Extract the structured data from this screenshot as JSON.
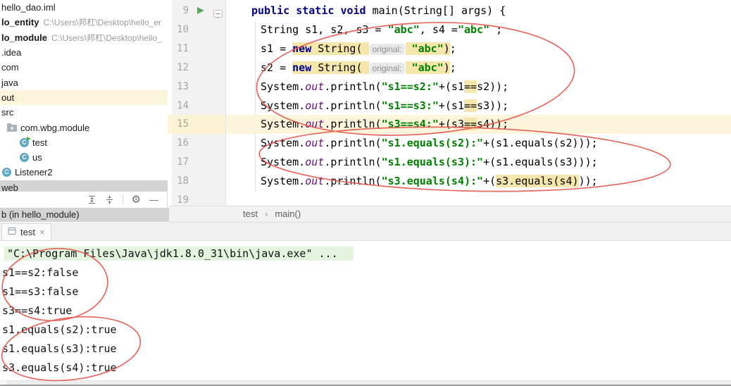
{
  "colors": {
    "keyword": "#000080",
    "string": "#008000",
    "field": "#660E7A",
    "token_highlight": "#F5E6AC",
    "current_line": "#FCF5DB",
    "run_command_bg": "#E4F4DE",
    "annotation": "#E3584F",
    "selection_row": "#D4D4D4",
    "gutter_bg": "#F2F2F2"
  },
  "sidebar": {
    "items": [
      {
        "label": "hello_dao.iml"
      },
      {
        "label": "lo_entity",
        "path": "C:\\Users\\邦杠\\Desktop\\hello_er",
        "bold": true
      },
      {
        "label": "lo_module",
        "path": "C:\\Users\\邦杠\\Desktop\\hello_",
        "bold": true
      },
      {
        "label": ".idea"
      },
      {
        "label": "com"
      },
      {
        "label": "java"
      },
      {
        "label": "out",
        "row_highlight": true
      },
      {
        "label": "src"
      },
      {
        "label": "com.wbg.module",
        "icon": "package-icon",
        "indent": 10
      },
      {
        "label": "test",
        "icon": "class-run-icon",
        "indent": 28
      },
      {
        "label": "us",
        "icon": "class-icon",
        "indent": 28
      },
      {
        "label": "Listener2",
        "icon": "class-icon",
        "indent": 3
      },
      {
        "label": "web",
        "selected": true
      }
    ],
    "class_icon_letter": "C",
    "toolbar_icons": [
      "expand-all-icon",
      "collapse-all-icon",
      "settings-gear-icon",
      "hide-icon"
    ],
    "status_row": "b (in hello_module)"
  },
  "editor": {
    "lines": [
      {
        "n": "9",
        "run": true,
        "indent": 0,
        "tokens": [
          {
            "c": "kw",
            "s": "public "
          },
          {
            "c": "kw",
            "s": "static "
          },
          {
            "c": "kw",
            "s": "void "
          },
          {
            "c": "pl",
            "s": "main(String[] args) {"
          }
        ]
      },
      {
        "n": "10",
        "indent": 1,
        "tokens": [
          {
            "c": "pl",
            "s": "String s1, s2, s3 = "
          },
          {
            "c": "str",
            "s": "\"abc\""
          },
          {
            "c": "pl",
            "s": ", s4 ="
          },
          {
            "c": "str",
            "s": "\"abc\""
          },
          {
            "c": "pl",
            "s": " ;"
          }
        ]
      },
      {
        "n": "11",
        "indent": 1,
        "tokens": [
          {
            "c": "pl",
            "s": "s1 = "
          },
          {
            "c": "kw",
            "s": "new",
            "hl": true
          },
          {
            "c": "pl",
            "s": " String( ",
            "hl": true
          },
          {
            "c": "hint",
            "s": "original:",
            "hl": true
          },
          {
            "c": "str",
            "s": " \"abc\"",
            "hl": true
          },
          {
            "c": "pl",
            "s": ")",
            "hl": true
          },
          {
            "c": "pl",
            "s": ";"
          }
        ]
      },
      {
        "n": "12",
        "indent": 1,
        "tokens": [
          {
            "c": "pl",
            "s": "s2 = "
          },
          {
            "c": "kw",
            "s": "new",
            "hl": true
          },
          {
            "c": "pl",
            "s": " String( ",
            "hl": true
          },
          {
            "c": "hint",
            "s": "original:",
            "hl": true
          },
          {
            "c": "str",
            "s": " \"abc\"",
            "hl": true
          },
          {
            "c": "pl",
            "s": ")",
            "hl": true
          },
          {
            "c": "pl",
            "s": ";"
          }
        ]
      },
      {
        "n": "13",
        "indent": 1,
        "tokens": [
          {
            "c": "pl",
            "s": "System."
          },
          {
            "c": "fld",
            "s": "out"
          },
          {
            "c": "pl",
            "s": ".println("
          },
          {
            "c": "str",
            "s": "\"s1==s2:\""
          },
          {
            "c": "pl",
            "s": "+(s1"
          },
          {
            "c": "pl",
            "s": "==",
            "hl": true
          },
          {
            "c": "pl",
            "s": "s2));"
          }
        ]
      },
      {
        "n": "14",
        "indent": 1,
        "tokens": [
          {
            "c": "pl",
            "s": "System."
          },
          {
            "c": "fld",
            "s": "out"
          },
          {
            "c": "pl",
            "s": ".println("
          },
          {
            "c": "str",
            "s": "\"s1==s3:\""
          },
          {
            "c": "pl",
            "s": "+(s1"
          },
          {
            "c": "pl",
            "s": "==",
            "hl": true
          },
          {
            "c": "pl",
            "s": "s3));"
          }
        ]
      },
      {
        "n": "15",
        "indent": 1,
        "current": true,
        "tokens": [
          {
            "c": "pl",
            "s": "System."
          },
          {
            "c": "fld",
            "s": "out"
          },
          {
            "c": "pl",
            "s": ".println("
          },
          {
            "c": "str",
            "s": "\"s3==s4:\""
          },
          {
            "c": "pl",
            "s": "+(s3"
          },
          {
            "c": "pl",
            "s": "==",
            "hl": true
          },
          {
            "c": "pl",
            "s": "s4));"
          }
        ]
      },
      {
        "n": "16",
        "indent": 1,
        "tokens": [
          {
            "c": "pl",
            "s": "System."
          },
          {
            "c": "fld",
            "s": "out"
          },
          {
            "c": "pl",
            "s": ".println("
          },
          {
            "c": "str",
            "s": "\"s1.equals(s2):\""
          },
          {
            "c": "pl",
            "s": "+(s1.equals(s2)));"
          }
        ]
      },
      {
        "n": "17",
        "indent": 1,
        "tokens": [
          {
            "c": "pl",
            "s": "System."
          },
          {
            "c": "fld",
            "s": "out"
          },
          {
            "c": "pl",
            "s": ".println("
          },
          {
            "c": "str",
            "s": "\"s1.equals(s3):\""
          },
          {
            "c": "pl",
            "s": "+(s1.equals(s3)));"
          }
        ]
      },
      {
        "n": "18",
        "indent": 1,
        "tokens": [
          {
            "c": "pl",
            "s": "System."
          },
          {
            "c": "fld",
            "s": "out"
          },
          {
            "c": "pl",
            "s": ".println("
          },
          {
            "c": "str",
            "s": "\"s3.equals(s4):\""
          },
          {
            "c": "pl",
            "s": "+("
          },
          {
            "c": "pl",
            "s": "s3.equals(s4)",
            "hl": true
          },
          {
            "c": "pl",
            "s": "));"
          }
        ]
      },
      {
        "n": "19",
        "indent": 1,
        "tokens": []
      }
    ],
    "breadcrumbs": {
      "items": [
        "test",
        "main()"
      ],
      "separator": "›"
    }
  },
  "run_panel": {
    "tab": {
      "label": "test",
      "close_glyph": "×",
      "icon": "run-config-icon"
    },
    "console": [
      {
        "text": "\"C:\\Program Files\\Java\\jdk1.8.0_31\\bin\\java.exe\" ...",
        "highlight": true
      },
      {
        "text": "s1==s2:false"
      },
      {
        "text": "s1==s3:false"
      },
      {
        "text": "s3==s4:true"
      },
      {
        "text": "s1.equals(s2):true"
      },
      {
        "text": "s1.equals(s3):true"
      },
      {
        "text": "s3.equals(s4):true"
      }
    ]
  },
  "annotations": {
    "color": "#E3584F",
    "shapes": [
      "code-ellipse-upper",
      "code-ellipse-lower",
      "console-ellipse-upper",
      "console-ellipse-lower"
    ]
  }
}
